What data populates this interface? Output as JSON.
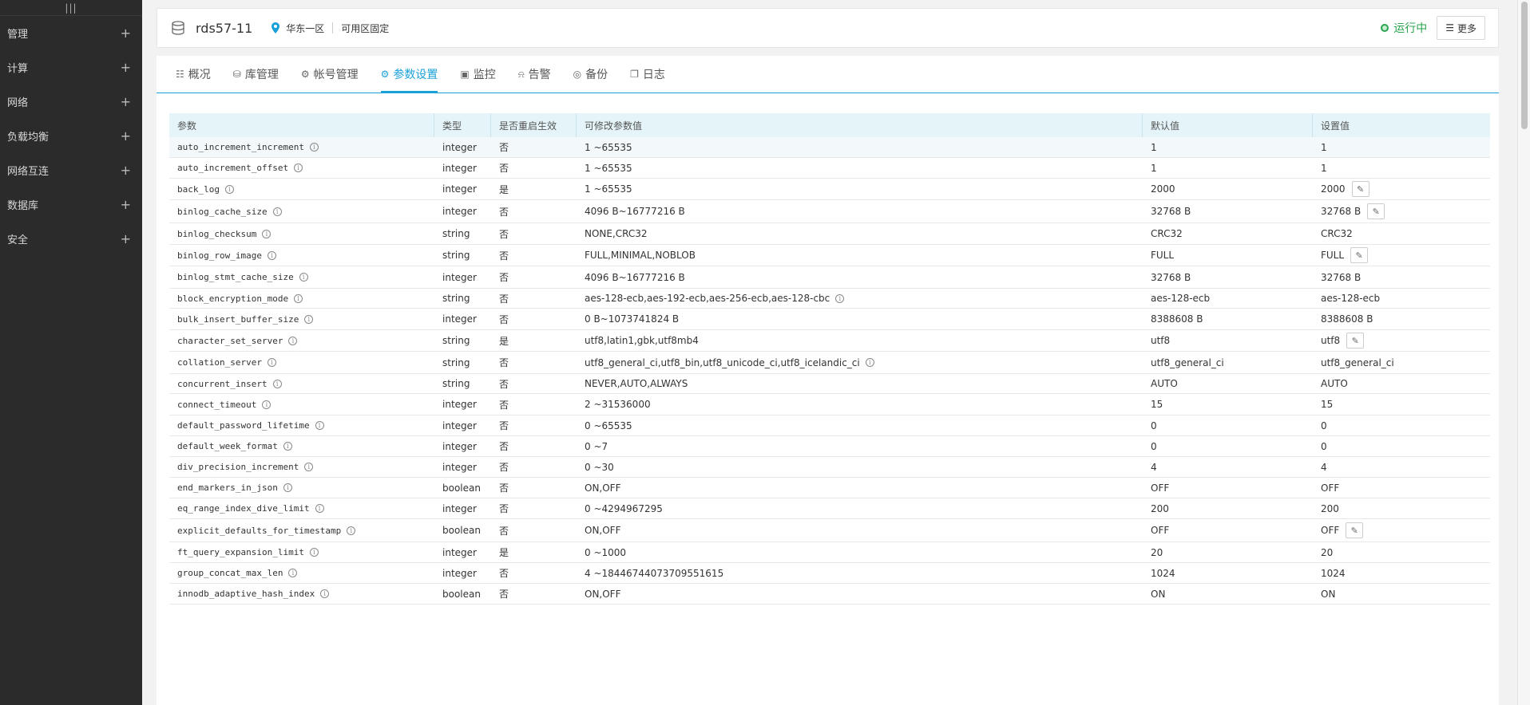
{
  "sidebar": {
    "collapse_label": "|||",
    "items": [
      {
        "label": "管理",
        "expand": "+"
      },
      {
        "label": "计算",
        "expand": "+"
      },
      {
        "label": "网络",
        "expand": "+"
      },
      {
        "label": "负载均衡",
        "expand": "+"
      },
      {
        "label": "网络互连",
        "expand": "+"
      },
      {
        "label": "数据库",
        "expand": "+"
      },
      {
        "label": "安全",
        "expand": "+"
      }
    ]
  },
  "header": {
    "instance_name": "rds57-11",
    "region": "华东一区",
    "zone": "可用区固定",
    "status": "运行中",
    "status_color": "#2aa44f",
    "more_label": "更多",
    "more_icon": "menu-icon"
  },
  "tabs": [
    {
      "label": "概况",
      "icon": "overview-icon"
    },
    {
      "label": "库管理",
      "icon": "database-icon"
    },
    {
      "label": "帐号管理",
      "icon": "account-icon"
    },
    {
      "label": "参数设置",
      "icon": "settings-icon",
      "active": true
    },
    {
      "label": "监控",
      "icon": "monitor-icon"
    },
    {
      "label": "告警",
      "icon": "alarm-icon"
    },
    {
      "label": "备份",
      "icon": "backup-icon"
    },
    {
      "label": "日志",
      "icon": "log-icon"
    }
  ],
  "accent_color": "#1aa0d8",
  "table": {
    "columns": [
      "参数",
      "类型",
      "是否重启生效",
      "可修改参数值",
      "默认值",
      "设置值"
    ],
    "rows": [
      {
        "name": "auto_increment_increment",
        "type": "integer",
        "restart": "否",
        "range": "1 ~65535",
        "default": "1",
        "value": "1"
      },
      {
        "name": "auto_increment_offset",
        "type": "integer",
        "restart": "否",
        "range": "1 ~65535",
        "default": "1",
        "value": "1"
      },
      {
        "name": "back_log",
        "type": "integer",
        "restart": "是",
        "range": "1 ~65535",
        "default": "2000",
        "value": "2000",
        "editable": true
      },
      {
        "name": "binlog_cache_size",
        "type": "integer",
        "restart": "否",
        "range": "4096 B~16777216 B",
        "default": "32768 B",
        "value": "32768 B",
        "editable": true
      },
      {
        "name": "binlog_checksum",
        "type": "string",
        "restart": "否",
        "range": "NONE,CRC32",
        "default": "CRC32",
        "value": "CRC32"
      },
      {
        "name": "binlog_row_image",
        "type": "string",
        "restart": "否",
        "range": "FULL,MINIMAL,NOBLOB",
        "default": "FULL",
        "value": "FULL",
        "editable": true
      },
      {
        "name": "binlog_stmt_cache_size",
        "type": "integer",
        "restart": "否",
        "range": "4096 B~16777216 B",
        "default": "32768 B",
        "value": "32768 B"
      },
      {
        "name": "block_encryption_mode",
        "type": "string",
        "restart": "否",
        "range": "aes-128-ecb,aes-192-ecb,aes-256-ecb,aes-128-cbc",
        "range_info": true,
        "default": "aes-128-ecb",
        "value": "aes-128-ecb"
      },
      {
        "name": "bulk_insert_buffer_size",
        "type": "integer",
        "restart": "否",
        "range": "0 B~1073741824 B",
        "default": "8388608 B",
        "value": "8388608 B"
      },
      {
        "name": "character_set_server",
        "type": "string",
        "restart": "是",
        "range": "utf8,latin1,gbk,utf8mb4",
        "default": "utf8",
        "value": "utf8",
        "editable": true
      },
      {
        "name": "collation_server",
        "type": "string",
        "restart": "否",
        "range": "utf8_general_ci,utf8_bin,utf8_unicode_ci,utf8_icelandic_ci",
        "range_info": true,
        "default": "utf8_general_ci",
        "value": "utf8_general_ci"
      },
      {
        "name": "concurrent_insert",
        "type": "string",
        "restart": "否",
        "range": "NEVER,AUTO,ALWAYS",
        "default": "AUTO",
        "value": "AUTO"
      },
      {
        "name": "connect_timeout",
        "type": "integer",
        "restart": "否",
        "range": "2 ~31536000",
        "default": "15",
        "value": "15"
      },
      {
        "name": "default_password_lifetime",
        "type": "integer",
        "restart": "否",
        "range": "0 ~65535",
        "default": "0",
        "value": "0"
      },
      {
        "name": "default_week_format",
        "type": "integer",
        "restart": "否",
        "range": "0 ~7",
        "default": "0",
        "value": "0"
      },
      {
        "name": "div_precision_increment",
        "type": "integer",
        "restart": "否",
        "range": "0 ~30",
        "default": "4",
        "value": "4"
      },
      {
        "name": "end_markers_in_json",
        "type": "boolean",
        "restart": "否",
        "range": "ON,OFF",
        "default": "OFF",
        "value": "OFF"
      },
      {
        "name": "eq_range_index_dive_limit",
        "type": "integer",
        "restart": "否",
        "range": "0 ~4294967295",
        "default": "200",
        "value": "200"
      },
      {
        "name": "explicit_defaults_for_timestamp",
        "type": "boolean",
        "restart": "否",
        "range": "ON,OFF",
        "default": "OFF",
        "value": "OFF",
        "editable": true
      },
      {
        "name": "ft_query_expansion_limit",
        "type": "integer",
        "restart": "是",
        "range": "0 ~1000",
        "default": "20",
        "value": "20"
      },
      {
        "name": "group_concat_max_len",
        "type": "integer",
        "restart": "否",
        "range": "4 ~18446744073709551615",
        "default": "1024",
        "value": "1024"
      },
      {
        "name": "innodb_adaptive_hash_index",
        "type": "boolean",
        "restart": "否",
        "range": "ON,OFF",
        "default": "ON",
        "value": "ON"
      }
    ]
  }
}
